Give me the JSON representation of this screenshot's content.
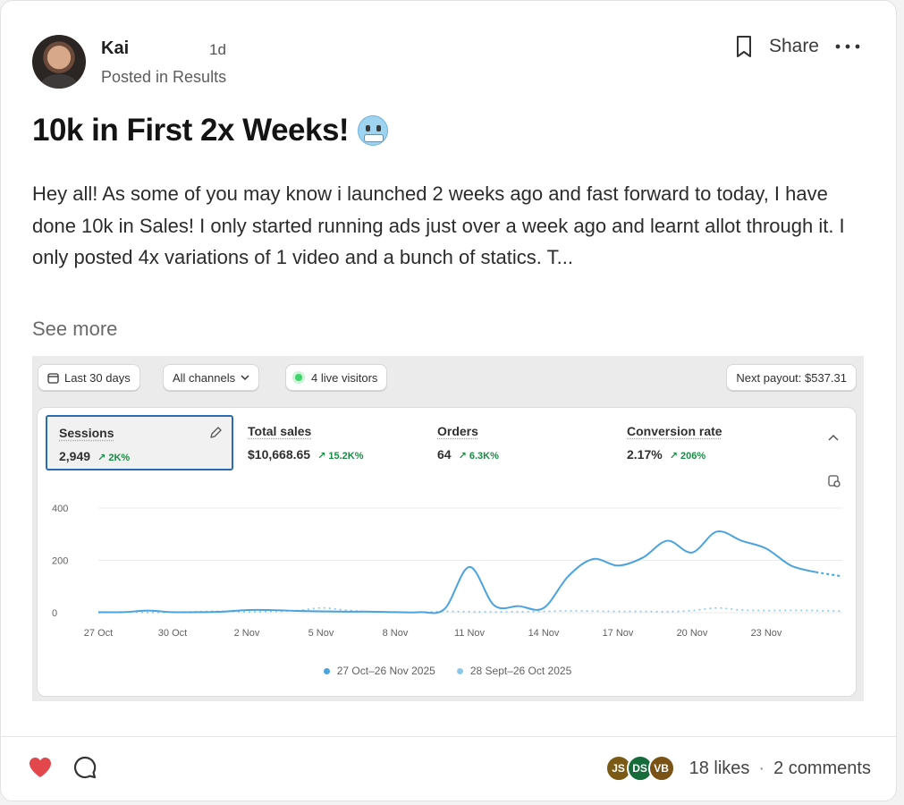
{
  "post": {
    "author": "Kai",
    "age": "1d",
    "posted_in": "Posted in Results",
    "share_label": "Share",
    "title": "10k in First 2x Weeks!",
    "body": "Hey all! As some of you may know i launched 2 weeks ago and fast forward to today, I have done 10k in Sales! I only started running ads just over a week ago and learnt allot through it. I only posted 4x variations of 1 video and a bunch of statics. T...",
    "see_more": "See more",
    "icons": [
      "bookmark-icon",
      "more-icon",
      "heart-icon",
      "comment-icon"
    ]
  },
  "dashboard": {
    "filters": {
      "date_range": "Last 30 days",
      "channels": "All channels",
      "live_visitors": "4 live visitors",
      "payout": "Next payout: $537.31"
    },
    "metrics": [
      {
        "label": "Sessions",
        "value": "2,949",
        "change": "↗ 2K%"
      },
      {
        "label": "Total sales",
        "value": "$10,668.65",
        "change": "↗ 15.2K%"
      },
      {
        "label": "Orders",
        "value": "64",
        "change": "↗ 6.3K%"
      },
      {
        "label": "Conversion rate",
        "value": "2.17%",
        "change": "↗ 206%"
      }
    ],
    "colors": {
      "current": "#4aa3df",
      "previous": "#8cc7ea",
      "positive": "#1c8a46"
    }
  },
  "chart_data": {
    "type": "line",
    "title": "",
    "ylim": [
      0,
      400
    ],
    "y_ticks": [
      "0",
      "200",
      "400"
    ],
    "x_ticks": [
      "27 Oct",
      "30 Oct",
      "2 Nov",
      "5 Nov",
      "8 Nov",
      "11 Nov",
      "14 Nov",
      "17 Nov",
      "20 Nov",
      "23 Nov"
    ],
    "x": [
      "27 Oct",
      "28 Oct",
      "29 Oct",
      "30 Oct",
      "31 Oct",
      "1 Nov",
      "2 Nov",
      "3 Nov",
      "4 Nov",
      "5 Nov",
      "6 Nov",
      "7 Nov",
      "8 Nov",
      "9 Nov",
      "10 Nov",
      "11 Nov",
      "12 Nov",
      "13 Nov",
      "14 Nov",
      "15 Nov",
      "16 Nov",
      "17 Nov",
      "18 Nov",
      "19 Nov",
      "20 Nov",
      "21 Nov",
      "22 Nov",
      "23 Nov",
      "24 Nov",
      "25 Nov",
      "26 Nov"
    ],
    "series": [
      {
        "name": "27 Oct–26 Nov 2025",
        "values": [
          2,
          2,
          8,
          2,
          2,
          4,
          10,
          10,
          7,
          5,
          4,
          4,
          2,
          2,
          15,
          175,
          28,
          25,
          18,
          140,
          205,
          180,
          210,
          275,
          230,
          310,
          275,
          245,
          180,
          155,
          140
        ],
        "projected_from": 29
      },
      {
        "name": "28 Sept–26 Oct 2025",
        "values": [
          0,
          3,
          1,
          2,
          4,
          6,
          3,
          5,
          8,
          18,
          10,
          4,
          3,
          2,
          5,
          4,
          3,
          4,
          5,
          7,
          6,
          5,
          5,
          4,
          8,
          18,
          10,
          8,
          9,
          8,
          6
        ]
      }
    ]
  },
  "footer": {
    "likers": [
      "JS",
      "DS",
      "VB"
    ],
    "liker_colors": [
      "#7a5a14",
      "#166b3a",
      "#7a5216"
    ],
    "likes": "18 likes",
    "separator": "·",
    "comments": "2 comments"
  }
}
